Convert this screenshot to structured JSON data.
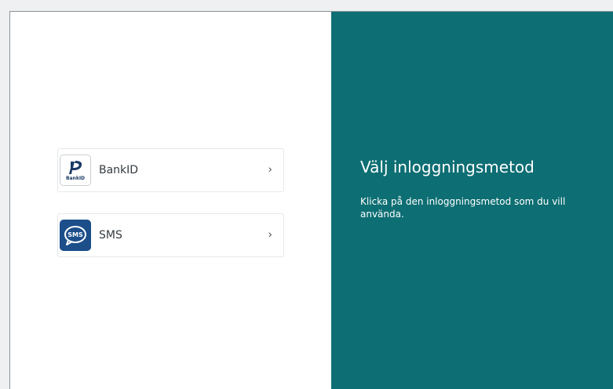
{
  "login": {
    "methods": [
      {
        "label": "BankID",
        "icon": "bankid-logo-icon",
        "icon_text": "BankID",
        "chevron": "›"
      },
      {
        "label": "SMS",
        "icon": "sms-icon",
        "icon_text": "SMS",
        "chevron": "›"
      }
    ]
  },
  "info": {
    "title": "Välj inloggningsmetod",
    "description": "Klicka på den inloggningsmetod som du vill använda."
  },
  "colors": {
    "panel_background": "#0d6e73",
    "sms_icon_background": "#1c4e8a",
    "bankid_logo": "#1b3a66"
  }
}
